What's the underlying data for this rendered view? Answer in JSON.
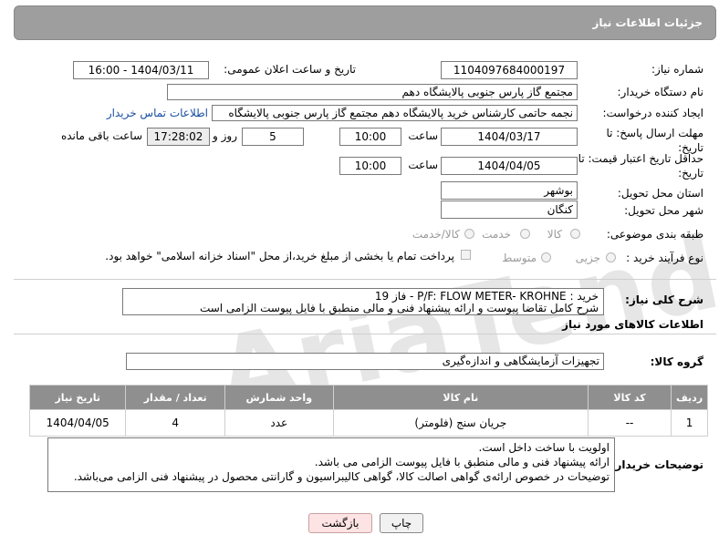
{
  "header": {
    "title": "جزئیات اطلاعات نیاز"
  },
  "watermark": "AriaTender.neT",
  "fields": {
    "need_number_label": "شماره نیاز:",
    "need_number": "1104097684000197",
    "announce_label": "تاریخ و ساعت اعلان عمومی:",
    "announce_value": "1404/03/11 - 16:00",
    "buyer_label": "نام دستگاه خریدار:",
    "buyer_value": "مجتمع گاز پارس جنوبی  پالایشگاه دهم",
    "creator_label": "ایجاد کننده درخواست:",
    "creator_value": "نجمه حاتمی کارشناس خرید پالایشگاه دهم  مجتمع گاز پارس جنوبی  پالایشگاه",
    "contact_link": "اطلاعات تماس خریدار",
    "deadline_label": "مهلت ارسال پاسخ: تا تاریخ:",
    "deadline_date": "1404/03/17",
    "time_word": "ساعت",
    "deadline_time": "10:00",
    "days_value": "5",
    "days_word": "روز و",
    "remaining_value": "17:28:02",
    "remaining_label": "ساعت باقی مانده",
    "price_label": "حداقل تاریخ اعتبار قیمت: تا تاریخ:",
    "price_date": "1404/04/05",
    "price_time": "10:00",
    "province_label": "استان محل تحویل:",
    "province_value": "بوشهر",
    "city_label": "شهر محل تحویل:",
    "city_value": "کنگان",
    "category_label": "طبقه بندی موضوعی:",
    "category_opts": [
      "کالا",
      "خدمت",
      "کالا/خدمت"
    ],
    "process_label": "نوع فرآیند خرید :",
    "process_opts": [
      "جزیی",
      "متوسط"
    ],
    "process_note": "پرداخت تمام یا بخشی از مبلغ خرید،از محل \"اسناد خزانه اسلامی\" خواهد بود.",
    "desc_label": "شرح کلی نیاز:",
    "desc_line1": "خرید : P/F: FLOW METER- KROHNE - فاز 19",
    "desc_line2": "شرح کامل تقاضا پیوست و ارائه پیشنهاد فنی و مالی منطبق با فایل پیوست الزامی است"
  },
  "goods_section": {
    "title": "اطلاعات کالاهای مورد نیاز",
    "group_label": "گروه کالا:",
    "group_value": "تجهیزات آزمایشگاهی و اندازه‌گیری"
  },
  "table": {
    "headers": [
      "ردیف",
      "کد کالا",
      "نام کالا",
      "واحد شمارش",
      "تعداد / مقدار",
      "تاریخ نیاز"
    ],
    "rows": [
      [
        "1",
        "--",
        "جریان سنج (فلومتر)",
        "عدد",
        "4",
        "1404/04/05"
      ]
    ]
  },
  "buyer_notes": {
    "label": "توضیحات خریدار:",
    "line1": "اولویت با ساخت داخل است.",
    "line2": "ارائه پیشنهاد فنی و مالی منطبق با فایل پیوست الزامی می باشد.",
    "line3": "توضیحات در خصوص ارائه‌ی گواهی اصالت کالا، گواهی کالیبراسیون و گارانتی محصول در پیشنهاد فنی الزامی می‌باشد."
  },
  "buttons": {
    "print": "چاپ",
    "back": "بازگشت"
  }
}
